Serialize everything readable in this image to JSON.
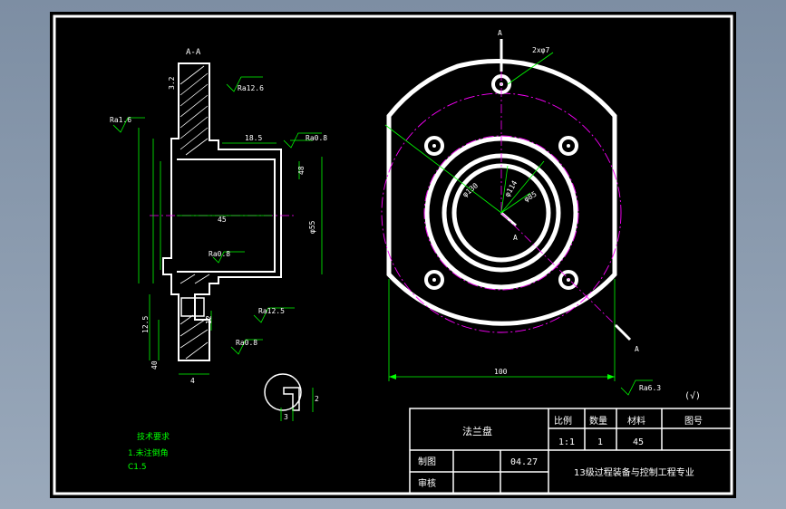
{
  "section_label": "A-A",
  "cut_marks": {
    "top": "A",
    "center": "A",
    "bottom": "A"
  },
  "left_view": {
    "roughness": [
      "Ra12.6",
      "Ra1.6",
      "Ra0.8",
      "Ra0.8",
      "Ra12.5",
      "Ra0.8"
    ],
    "dims": [
      "3.2",
      "18.5",
      "45",
      "48",
      "12.5",
      "12",
      "40",
      "4",
      "3",
      "2"
    ],
    "tolerance": "φ55"
  },
  "right_view": {
    "holes": "2xφ7",
    "diameters": [
      "φ130",
      "φ114",
      "φ85"
    ],
    "width": "100"
  },
  "general_roughness": {
    "value": "Ra6.3",
    "mark": "(√)"
  },
  "tech_requirements": {
    "title": "技术要求",
    "item": "1.未注倒角",
    "chamfer": "C1.5"
  },
  "title_block": {
    "part_name": "法兰盘",
    "hdr_scale": "比例",
    "hdr_qty": "数量",
    "hdr_material": "材料",
    "hdr_drawing_no": "图号",
    "scale": "1:1",
    "qty": "1",
    "material": "45",
    "drawn_label": "制图",
    "drawn_date": "04.27",
    "checked_label": "审核",
    "organization": "13级过程装备与控制工程专业"
  }
}
